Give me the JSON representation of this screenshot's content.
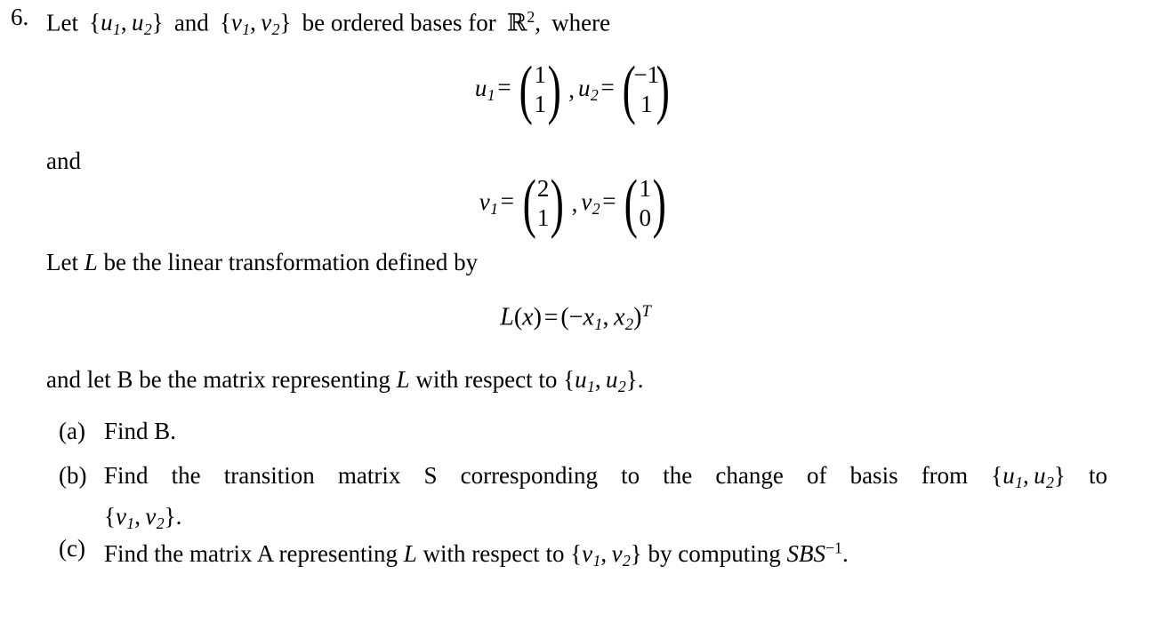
{
  "document": {
    "problem_number": "6.",
    "intro": {
      "text_before": "Let ",
      "basis_u": "{u₁, u₂}",
      "text_mid": " and ",
      "basis_v": "{v₁, v₂}",
      "text_after": " be ordered bases for ℝ², where",
      "words": {
        "let": "Let",
        "and": "and",
        "be_ordered_bases_for": "be ordered bases for",
        "where": "where"
      },
      "field_symbol": "R",
      "field_exponent": "2",
      "comma": ","
    },
    "equation_u": {
      "lhs_1": "u",
      "lhs_1_sub": "1",
      "equals": "=",
      "vector_1": [
        "1",
        "1"
      ],
      "separator": ",",
      "lhs_2": "u",
      "lhs_2_sub": "2",
      "vector_2": [
        "−1",
        "1"
      ]
    },
    "connector_and": "and",
    "equation_v": {
      "lhs_1": "v",
      "lhs_1_sub": "1",
      "equals": "=",
      "vector_1": [
        "2",
        "1"
      ],
      "separator": ",",
      "lhs_2": "v",
      "lhs_2_sub": "2",
      "vector_2": [
        "1",
        "0"
      ]
    },
    "line_let_L": {
      "before": "Let ",
      "symbol": "L",
      "after": " be the linear transformation defined by"
    },
    "equation_L": {
      "func": "L",
      "open": "(",
      "arg": "x",
      "close": ")",
      "equals": "=",
      "rhs_open": "(",
      "minus": "−",
      "x1": "x",
      "x1_sub": "1",
      "comma": ",",
      "x2": "x",
      "x2_sub": "2",
      "rhs_close": ")",
      "transpose": "T"
    },
    "line_let_B": {
      "before": "and let B be the matrix representing ",
      "symbol": "L",
      "after": " with respect to ",
      "basis": "{u₁, u₂}",
      "period": "."
    },
    "items": [
      {
        "label": "(a)",
        "text": "Find B.",
        "words": {
          "find": "Find",
          "matrix": "B",
          "period": "."
        }
      },
      {
        "label": "(b)",
        "line1_words": [
          "Find",
          "the",
          "transition",
          "matrix",
          "S",
          "corresponding",
          "to",
          "the",
          "change",
          "of",
          "basis",
          "from"
        ],
        "line1_basis": "{u₁, u₂}",
        "line1_tail": "to",
        "line2_basis": "{v₁, v₂}",
        "line2_period": "."
      },
      {
        "label": "(c)",
        "before": "Find the matrix A representing ",
        "symbol_L": "L",
        "middle": " with respect to ",
        "basis": "{v₁, v₂}",
        "after": " by computing ",
        "expr_S1": "S",
        "expr_B": "B",
        "expr_S2": "S",
        "expr_exp": "−1",
        "period": "."
      }
    ]
  },
  "colors": {
    "background": "#ffffff",
    "text": "#000000"
  }
}
